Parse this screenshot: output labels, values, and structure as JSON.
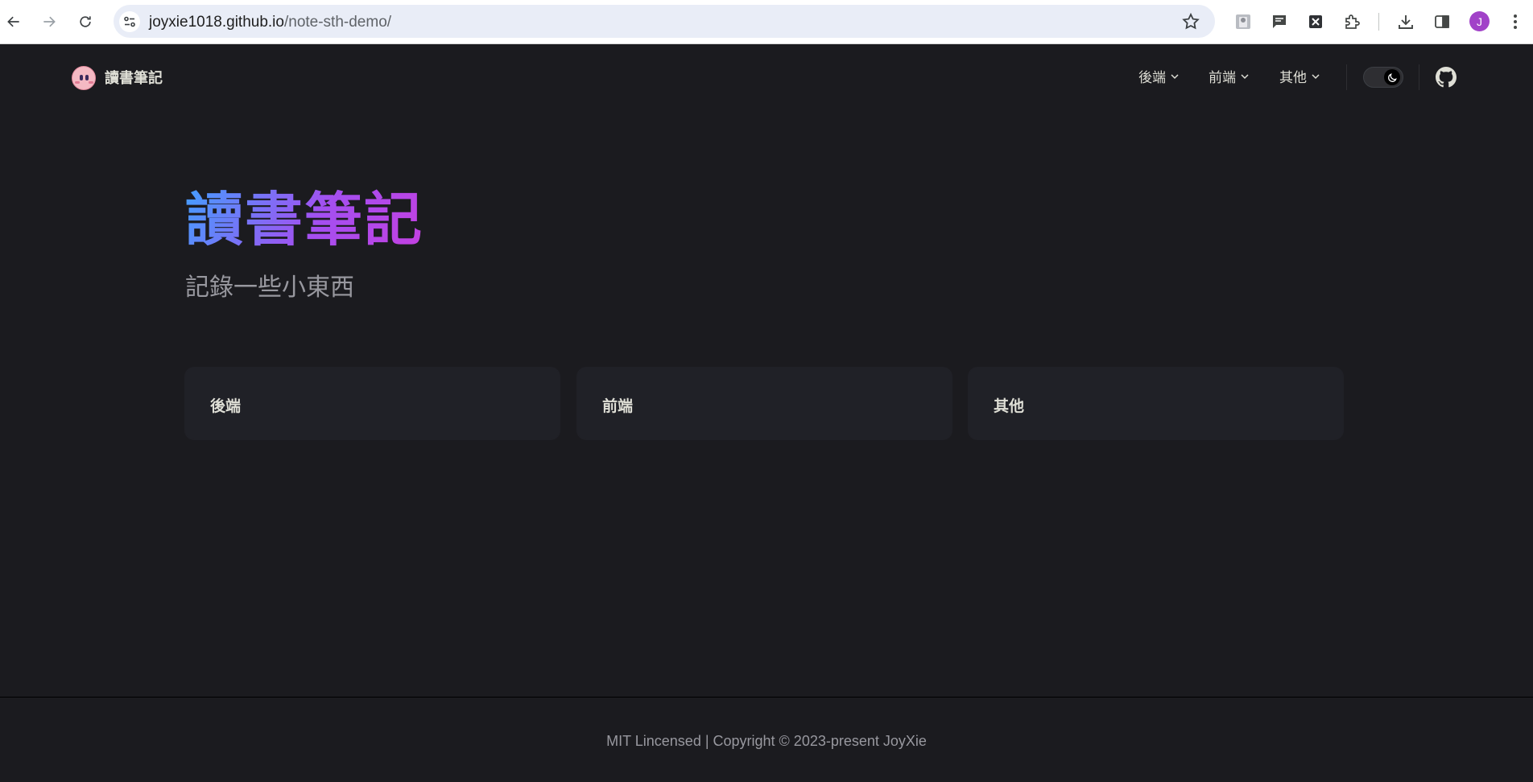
{
  "browser": {
    "url_host": "joyxie1018.github.io",
    "url_path": "/note-sth-demo/",
    "profile_initial": "J",
    "icons": [
      "back-arrow-icon",
      "forward-arrow-icon",
      "reload-icon",
      "site-settings-icon",
      "bookmark-star-icon",
      "extension-image-icon",
      "chat-icon",
      "x-extension-icon",
      "puzzle-extensions-icon",
      "download-icon",
      "side-panel-icon",
      "more-menu-icon"
    ]
  },
  "nav": {
    "title": "讀書筆記",
    "menus": [
      {
        "label": "後端"
      },
      {
        "label": "前端"
      },
      {
        "label": "其他"
      }
    ],
    "icons": [
      "kirby-logo-icon",
      "chevron-down-icon",
      "moon-icon",
      "github-icon"
    ]
  },
  "hero": {
    "name": "讀書筆記",
    "tagline": "記錄一些小東西"
  },
  "features": [
    {
      "title": "後端"
    },
    {
      "title": "前端"
    },
    {
      "title": "其他"
    }
  ],
  "footer": {
    "copyright": "MIT Lincensed | Copyright © 2023-present JoyXie"
  },
  "colors": {
    "background": "#1b1b1f",
    "card": "#202127",
    "text": "#dfdfd6",
    "muted": "#98989f",
    "gradient_start": "#41a0ff",
    "gradient_end": "#c53fe0"
  }
}
